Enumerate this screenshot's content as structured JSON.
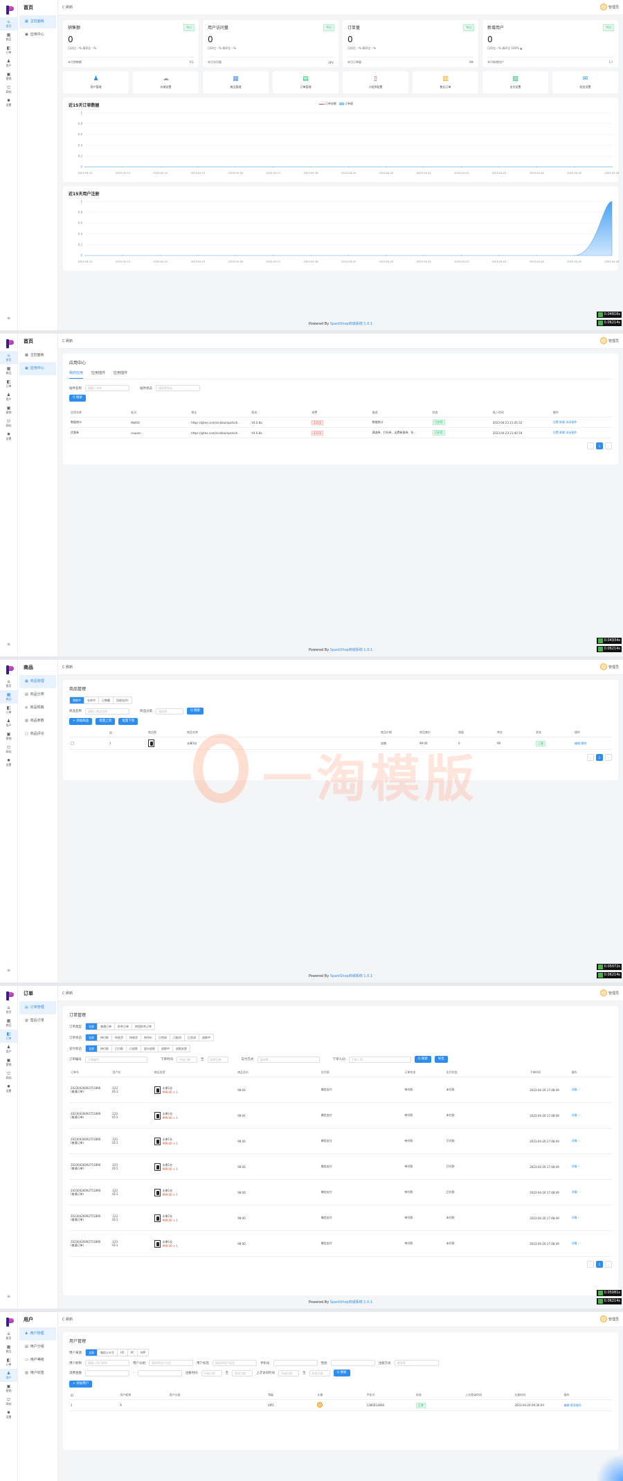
{
  "rail": [
    {
      "icon": "home-icon",
      "glyph": "⌂",
      "label": "首页"
    },
    {
      "icon": "product-icon",
      "glyph": "▦",
      "label": "商品"
    },
    {
      "icon": "order-icon",
      "glyph": "◧",
      "label": "订单"
    },
    {
      "icon": "user-icon",
      "glyph": "♟",
      "label": "用户"
    },
    {
      "icon": "marketing-icon",
      "glyph": "▣",
      "label": "营销"
    },
    {
      "icon": "store-icon",
      "glyph": "⛫",
      "label": "网站"
    },
    {
      "icon": "settings-icon",
      "glyph": "✹",
      "label": "设置"
    }
  ],
  "common": {
    "refresh": "C 刷新",
    "admin": "管理员",
    "footer_prefix": "Powered By ",
    "footer_link": "SparkShop商城系统 1.0.1"
  },
  "badges": [
    "0.04816s",
    "0.06214s",
    "0.04934s",
    "0.06214s",
    "0.05072s",
    "0.06214s",
    "0.05081s",
    "0.06214s"
  ],
  "dashboard": {
    "sub_title": "首页",
    "sub_items": [
      "主控面板",
      "应用中心"
    ],
    "stats": [
      {
        "title": "销售额",
        "tag": "今日",
        "value": "0",
        "cmp": "日环比 --%  周环比 --%",
        "bottom_left": "本月销售额",
        "bottom_right": "0元"
      },
      {
        "title": "用户访问量",
        "tag": "今日",
        "value": "0",
        "cmp": "日环比 --%  周环比 --%",
        "bottom_left": "本月访问量",
        "bottom_right": "0PV"
      },
      {
        "title": "订单量",
        "tag": "今日",
        "value": "0",
        "cmp": "日环比 --%  周环比 --%",
        "bottom_left": "本月订单量",
        "bottom_right": "0单"
      },
      {
        "title": "新增用户",
        "tag": "今日",
        "value": "0",
        "cmp": "日环比 --%  周环比 100% ▲",
        "bottom_left": "本月新增用户",
        "bottom_right": "1人"
      }
    ],
    "quick": [
      {
        "icon": "user-manage-icon",
        "glyph": "♟",
        "color": "#2d8cf0",
        "label": "用户管理"
      },
      {
        "icon": "cloud-icon",
        "glyph": "☁",
        "color": "#9aa0a6",
        "label": "存储设置"
      },
      {
        "icon": "goods-icon",
        "glyph": "▦",
        "color": "#4a90e2",
        "label": "商品管理"
      },
      {
        "icon": "order-manage-icon",
        "glyph": "▤",
        "color": "#19be6b",
        "label": "订单管理"
      },
      {
        "icon": "mini-program-icon",
        "glyph": "▯",
        "color": "#ed4014",
        "label": "小程序配置"
      },
      {
        "icon": "shipping-icon",
        "glyph": "▥",
        "color": "#ff9900",
        "label": "售后订单"
      },
      {
        "icon": "payment-icon",
        "glyph": "▧",
        "color": "#19be6b",
        "label": "支付设置"
      },
      {
        "icon": "message-icon",
        "glyph": "✉",
        "color": "#2d8cf0",
        "label": "短信设置"
      }
    ]
  },
  "chart_data": [
    {
      "type": "line",
      "title": "近15天订单数据",
      "legend": [
        "订单金额",
        "订单量"
      ],
      "x": [
        "2023-04-12",
        "2023-04-13",
        "2023-04-14",
        "2023-04-15",
        "2023-04-16",
        "2023-04-17",
        "2023-04-18",
        "2023-04-19",
        "2023-04-20",
        "2023-04-21",
        "2023-04-22",
        "2023-04-23",
        "2023-04-24",
        "2023-04-25",
        "2023-04-26"
      ],
      "series": [
        {
          "name": "订单金额",
          "values": [
            0,
            0,
            0,
            0,
            0,
            0,
            0,
            0,
            0,
            0,
            0,
            0,
            0,
            0,
            0
          ]
        },
        {
          "name": "订单量",
          "values": [
            0,
            0,
            0,
            0,
            0,
            0,
            0,
            0,
            0,
            0,
            0,
            0,
            0,
            0,
            0
          ]
        }
      ],
      "yticks": [
        "1",
        "0.8",
        "0.6",
        "0.4",
        "0.2",
        "0"
      ],
      "ylim": [
        0,
        1
      ],
      "grid": true,
      "colors": {
        "line": "#e74c3c",
        "area": "#8cc8f5"
      }
    },
    {
      "type": "area",
      "title": "近15天用户注册",
      "x": [
        "2023-04-12",
        "2023-04-13",
        "2023-04-14",
        "2023-04-15",
        "2023-04-16",
        "2023-04-17",
        "2023-04-18",
        "2023-04-19",
        "2023-04-20",
        "2023-04-21",
        "2023-04-22",
        "2023-04-23",
        "2023-04-24",
        "2023-04-25",
        "2023-04-26"
      ],
      "series": [
        {
          "values": [
            0,
            0,
            0,
            0,
            0,
            0,
            0,
            0,
            0,
            0,
            0,
            0,
            0,
            0,
            1
          ]
        }
      ],
      "yticks": [
        "1",
        "0.8",
        "0.6",
        "0.4",
        "0.2",
        "0"
      ],
      "ylim": [
        0,
        1
      ],
      "grid": true,
      "colors": {
        "area": "#8cc8f5",
        "line": "#5aa7f0"
      }
    }
  ],
  "apps": {
    "sub_title": "首页",
    "sub_items": [
      "主控面板",
      "应用中心"
    ],
    "panel_title": "应用中心",
    "tabs": [
      "我的应用",
      "应用插件",
      "应用插件"
    ],
    "filter_name_label": "插件名称",
    "filter_name_placeholder": "请输入名称",
    "filter_status_label": "插件状态",
    "filter_status_placeholder": "请选择状态",
    "search": "Q 搜索",
    "columns": [
      "应用名称",
      "标识",
      "地址",
      "版本",
      "收费",
      "描述",
      "状态",
      "插入时间",
      "操作"
    ],
    "rows": [
      [
        "数据统计",
        "WoRiS",
        "https://gitee.com/nickbai/sparksh...",
        "V4.0.8a",
        "1.0.1",
        "数据统计",
        "已启用",
        "2023-04-23 21:45:32",
        "设置  卸载  关闭插件"
      ],
      [
        "优惠券",
        "coupon",
        "https://gitee.com/nickbai/sparksh...",
        "V4.0.8a",
        "1.0.1",
        "满减券、打折券、运费新客券、折...",
        "已启用",
        "2023-04-23 21:40:19",
        "设置  卸载  关闭插件"
      ]
    ],
    "page": "1"
  },
  "goods": {
    "sub_title": "商品",
    "sub_items": [
      "商品管理",
      "商品分类",
      "商品规格",
      "商品参数",
      "商品评论"
    ],
    "panel_title": "商品管理",
    "seg": [
      "销售中",
      "仓库中",
      "已售罄",
      "回收站(0)"
    ],
    "filter_name_label": "商品名称",
    "filter_name_placeholder": "请输入商品名称",
    "filter_cate_label": "商品分类",
    "filter_cate_placeholder": "请选择",
    "search": "Q 搜索",
    "actions": [
      "+ 添加商品",
      "批量上架",
      "批量下架"
    ],
    "columns": [
      "",
      "ID",
      "商品图",
      "商品名称",
      "",
      "",
      "",
      "",
      "商品价格",
      "商品售价",
      "销量",
      "库存",
      "状态",
      "操作"
    ],
    "row": [
      "",
      "1",
      "",
      "水果1仓",
      "",
      "",
      "",
      "",
      "实物",
      "99.00",
      "0",
      "99",
      "上架",
      "编辑  删除"
    ],
    "page": "1"
  },
  "orders": {
    "sub_title": "订单",
    "sub_items": [
      "订单管理",
      "售后订单"
    ],
    "panel_title": "订单管理",
    "type_label": "订单类型",
    "type_seg": [
      "全部",
      "普通订单",
      "秒杀订单",
      "拼团秒杀订单"
    ],
    "status_label": "订单状态",
    "status_seg": [
      "全部",
      "待付款",
      "待发货",
      "待收货",
      "待评价",
      "已完成",
      "已取消",
      "已关闭",
      "退款中"
    ],
    "pay_label": "支付状态",
    "pay_seg": [
      "全部",
      "待付款",
      "已付款",
      "已退款",
      "部分退款",
      "退款中",
      "退款失败"
    ],
    "sn_label": "订单编号",
    "sn_placeholder": "订单编号",
    "time_label": "下单时间",
    "time_start": "开始日期",
    "time_to": "至",
    "time_end": "结束日期",
    "pay_method_label": "支付方式",
    "pay_method_placeholder": "请选择",
    "buyer_label": "下单人ID",
    "buyer_placeholder": "下单人ID",
    "search": "Q 搜索",
    "export": "导出",
    "columns": [
      "订单号",
      "用户名",
      "商品信息",
      "",
      "商品总价",
      "",
      "实付款",
      "",
      "订单状态",
      "支付状态",
      "",
      "下单时间",
      "操作"
    ],
    "rows": [
      {
        "sn": "20230426092751896",
        "type": "(普通订单)",
        "user": "123",
        "uid": "ID:1",
        "goods": "水果1仓",
        "price": "¥99.00 × 1",
        "total": "99.00",
        "paid": "微信支付",
        "status": "待付款",
        "pay": "未付款",
        "time": "2023-04-26 17:48:49",
        "ops": "详情 ···"
      },
      {
        "sn": "20230426092751896",
        "type": "(普通订单)",
        "user": "123",
        "uid": "ID:1",
        "goods": "水果1仓",
        "price": "¥99.00 × 1",
        "total": "99.00",
        "paid": "微信支付",
        "status": "待付款",
        "pay": "未付款",
        "time": "2023-04-26 17:48:49",
        "ops": "详情 ···"
      },
      {
        "sn": "20230426092751896",
        "type": "(普通订单)",
        "user": "123",
        "uid": "ID:1",
        "goods": "水果1仓",
        "price": "¥99.00 × 1",
        "total": "99.00",
        "paid": "微信支付",
        "status": "待付款",
        "pay": "已付款",
        "time": "2023-04-26 17:48:49",
        "ops": "详情 ···"
      },
      {
        "sn": "20230426092751896",
        "type": "(普通订单)",
        "user": "123",
        "uid": "ID:1",
        "goods": "水果1仓",
        "price": "¥99.00 × 1",
        "total": "99.00",
        "paid": "微信支付",
        "status": "待付款",
        "pay": "已付款",
        "time": "2023-04-26 17:48:49",
        "ops": "详情 ···"
      },
      {
        "sn": "20230426092751896",
        "type": "(普通订单)",
        "user": "123",
        "uid": "ID:1",
        "goods": "水果1仓",
        "price": "¥99.00 × 1",
        "total": "99.00",
        "paid": "微信支付",
        "status": "待付款",
        "pay": "已付款",
        "time": "2023-04-26 17:48:49",
        "ops": "详情 ···"
      },
      {
        "sn": "20230426092751896",
        "type": "(普通订单)",
        "user": "123",
        "uid": "ID:1",
        "goods": "水果1仓",
        "price": "¥99.00 × 1",
        "total": "99.00",
        "paid": "微信支付",
        "status": "待付款",
        "pay": "未付款",
        "time": "2023-04-26 17:48:49",
        "ops": "详情 ···"
      },
      {
        "sn": "20230426092751896",
        "type": "(普通订单)",
        "user": "123",
        "uid": "ID:1",
        "goods": "水果1仓",
        "price": "¥99.00 × 1",
        "total": "99.00",
        "paid": "微信支付",
        "status": "待付款",
        "pay": "未付款",
        "time": "2023-04-26 17:48:49",
        "ops": "详情 ···"
      }
    ],
    "page": "1"
  },
  "users": {
    "sub_title": "用户",
    "sub_items": [
      "用户管理",
      "用户分组",
      "用户等级",
      "用户标签"
    ],
    "panel_title": "用户管理",
    "src_label": "用户来源",
    "src_seg": [
      "全部",
      "微信公众号",
      "H5",
      "PC",
      "APP"
    ],
    "f1_label": "用户昵称",
    "f1_ph": "请输入用户昵称",
    "f2_label": "用户分组",
    "f2_ph": "请选择用户分组",
    "f3_label": "用户标签",
    "f3_ph": "请选择用户标签",
    "f4_label": "手机号",
    "f5_label": "性别",
    "f6_label": "注册方式",
    "f6_ph": "请选择",
    "f7_label": "消费金额",
    "f8_label": "注册时间",
    "f8_start": "开始日期",
    "f8_to": "至",
    "f8_end": "结束日期",
    "f9_label": "上次访问时间",
    "f9_start": "开始日期",
    "f9_to": "至",
    "f9_end": "结束日期",
    "search": "Q 搜索",
    "add": "+ 添加用户",
    "columns": [
      "ID",
      "用户昵称",
      "用户分组",
      "",
      "等级",
      "头像",
      "手机号",
      "状态",
      "上次登录时间",
      "注册时间",
      "操作"
    ],
    "row": [
      "1",
      "A",
      "",
      "",
      "VIP1",
      "",
      "1380013800",
      "正常",
      "",
      "2023-04-26 09:36:04",
      "编辑  更多操作"
    ]
  }
}
